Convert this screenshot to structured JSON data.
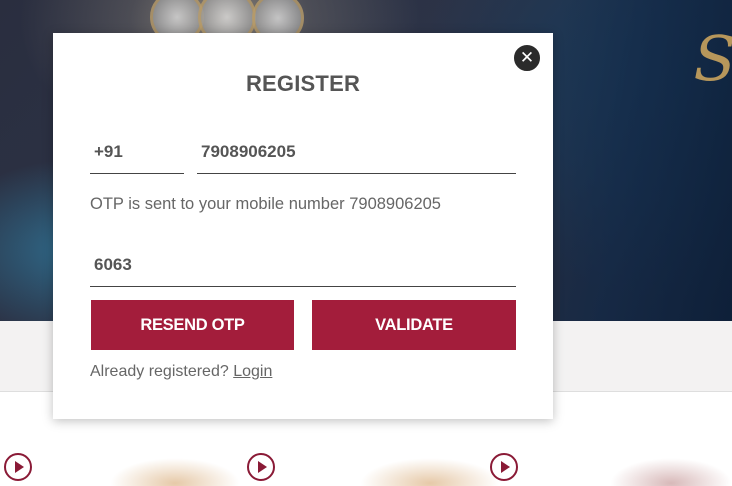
{
  "background": {
    "brand_color": "#a31d3b",
    "video_thumbnails": [
      {
        "icon": "play-icon"
      },
      {
        "icon": "play-icon"
      },
      {
        "icon": "play-icon"
      }
    ]
  },
  "modal": {
    "title": "REGISTER",
    "close_icon": "close-icon",
    "country_code": "+91",
    "mobile_number": "7908906205",
    "otp_note": "OTP is sent to your mobile number 7908906205",
    "otp_value": "6063",
    "resend_label": "RESEND OTP",
    "validate_label": "VALIDATE",
    "already_registered": "Already registered?",
    "login_label": "Login",
    "colors": {
      "button_bg": "#a31d3b",
      "button_text": "#ffffff",
      "close_bg": "#2b2b2b"
    }
  }
}
